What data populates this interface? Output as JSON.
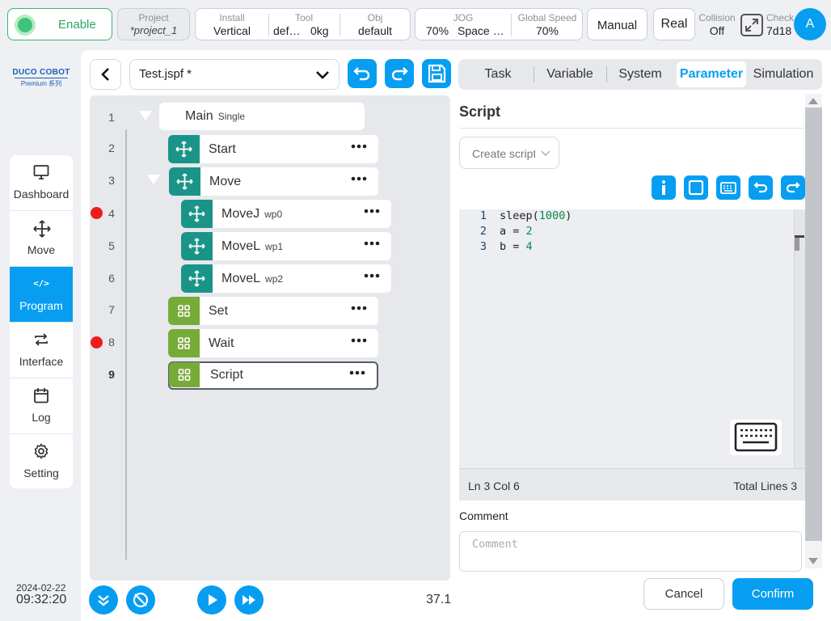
{
  "top_bar": {
    "enable_label": "Enable",
    "project": {
      "label": "Project",
      "value": "*project_1"
    },
    "install": {
      "label": "Install",
      "value": "Vertical"
    },
    "tool": {
      "label": "Tool",
      "value1": "def…",
      "value2": "0kg"
    },
    "obj": {
      "label": "Obj",
      "value": "default"
    },
    "jog": {
      "label": "JOG",
      "value1": "70%",
      "value2": "Space …"
    },
    "global_speed": {
      "label": "Global Speed",
      "value": "70%"
    },
    "mode_button": "Manual",
    "real_button": "Real",
    "collision": {
      "label": "Collision",
      "value": "Off"
    },
    "check": {
      "label": "Check",
      "value": "7d18"
    },
    "avatar": "A"
  },
  "brand": {
    "name": "DUCO COBOT",
    "sub": "Premium 系列"
  },
  "sidebar": {
    "items": [
      {
        "label": "Dashboard",
        "icon": "monitor-icon"
      },
      {
        "label": "Move",
        "icon": "move-arrows-icon"
      },
      {
        "label": "Program",
        "icon": "code-icon",
        "active": true
      },
      {
        "label": "Interface",
        "icon": "swap-icon"
      },
      {
        "label": "Log",
        "icon": "calendar-icon"
      },
      {
        "label": "Setting",
        "icon": "gear-icon"
      }
    ],
    "date": "2024-02-22",
    "time": "09:32:20"
  },
  "program": {
    "file_name": "Test.jspf *",
    "line_numbers": [
      "1",
      "2",
      "3",
      "4",
      "5",
      "6",
      "7",
      "8",
      "9"
    ],
    "tree": [
      {
        "label": "Main",
        "sub": "Single"
      },
      {
        "label": "Start"
      },
      {
        "label": "Move"
      },
      {
        "label": "MoveJ",
        "sub": "wp0",
        "breakpoint": true
      },
      {
        "label": "MoveL",
        "sub": "wp1"
      },
      {
        "label": "MoveL",
        "sub": "wp2"
      },
      {
        "label": "Set"
      },
      {
        "label": "Wait",
        "breakpoint": true
      },
      {
        "label": "Script",
        "selected": true
      }
    ],
    "speed_value": "37.1"
  },
  "right_panel": {
    "tabs": [
      "Task",
      "Variable",
      "System",
      "Parameter",
      "Simulation"
    ],
    "active_tab": "Parameter",
    "title": "Script",
    "create_script_placeholder": "Create script",
    "code_lines": [
      {
        "num": "1",
        "fn": "sleep(",
        "num_arg": "1000",
        "rest": ")"
      },
      {
        "num": "2",
        "text": "a = ",
        "num_arg": "2"
      },
      {
        "num": "3",
        "text": "b = ",
        "num_arg": "4"
      }
    ],
    "status_position": "Ln 3 Col 6",
    "status_total": "Total Lines 3",
    "comment_label": "Comment",
    "comment_placeholder": "Comment",
    "cancel_label": "Cancel",
    "confirm_label": "Confirm"
  },
  "colors": {
    "accent": "#079ef1",
    "teal": "#1a9488",
    "green": "#77ab38",
    "breakpoint": "#ee1c1c"
  }
}
